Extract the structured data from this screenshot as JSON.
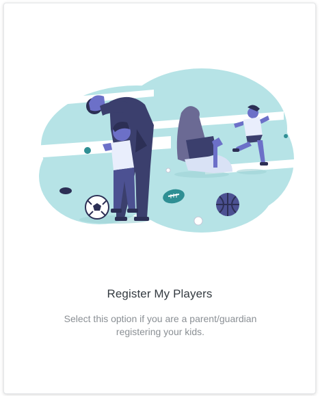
{
  "card": {
    "title": "Register My Players",
    "description": "Select this option if you are a parent/guardian registering your kids."
  },
  "colors": {
    "blob": "#b6e3e6",
    "stripe": "#ffffff",
    "figure_dark": "#3b3f6d",
    "figure_skin": "#6c70c8",
    "figure_light": "#e9eefc",
    "title_text": "#333a40",
    "desc_text": "#8a8f94"
  },
  "icons": [
    "family-sports-illustration",
    "soccer-ball-icon",
    "football-icon",
    "basketball-icon",
    "baseball-icon",
    "hockey-puck-icon"
  ]
}
